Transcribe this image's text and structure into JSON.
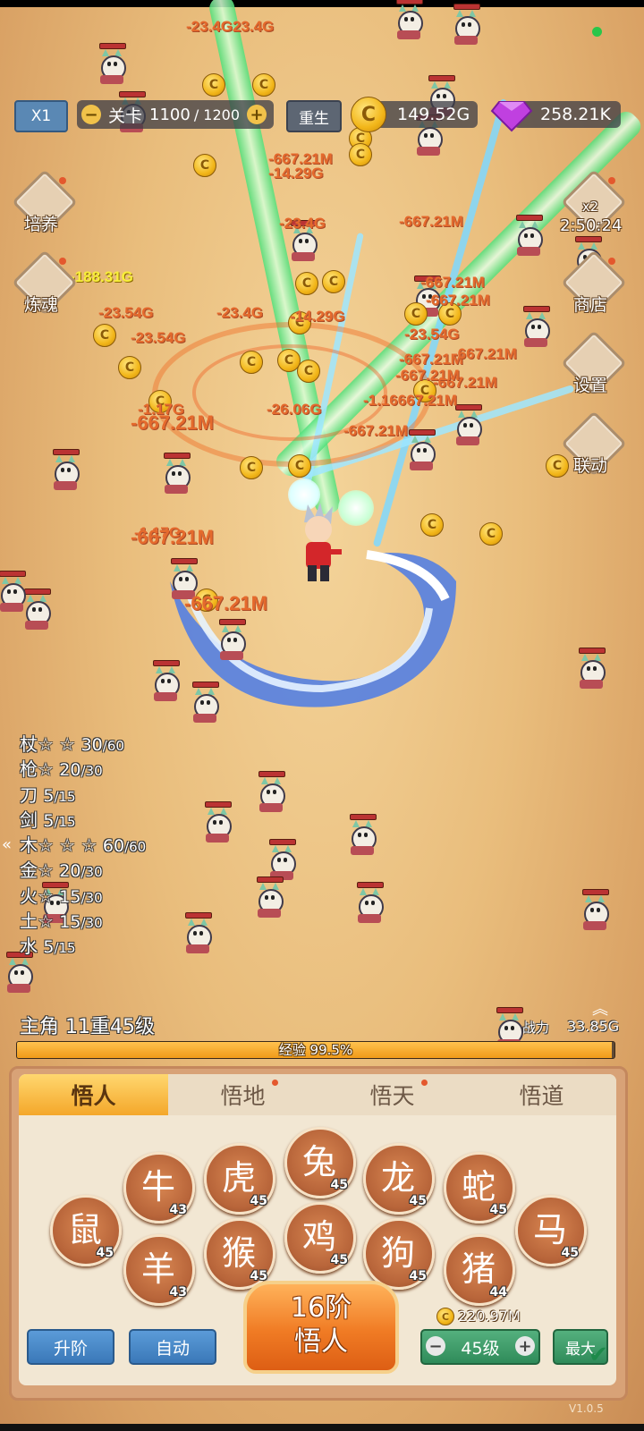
{
  "hud": {
    "speed_label": "X1",
    "level_label": "关卡",
    "level_current": "1100",
    "level_max": "/ 1200",
    "rebirth_label": "重生",
    "gold": "149.52G",
    "gems": "258.21K"
  },
  "side_left": [
    {
      "label": "培养"
    },
    {
      "label": "炼魂"
    }
  ],
  "side_right": [
    {
      "label": "x2",
      "timer": "2:50:24"
    },
    {
      "label": "商店"
    },
    {
      "label": "设置"
    },
    {
      "label": "联动"
    }
  ],
  "damage_texts": [
    "-23.4G23.4G",
    "-667.21M",
    "-14.29G",
    "-23.4G",
    "-667.21M",
    "-188.31G",
    "-23.54G",
    "-23.54G",
    "-23.4G",
    "-667.21M",
    "-14.29G",
    "-23.54G",
    "-667.21M",
    "-667.21M",
    "-667.21M",
    "-667.21M",
    "-1.17G",
    "-26.06G",
    "-1.16667.21M",
    "-667.21M",
    "-667.21M",
    "-1.17G",
    "-667.21M",
    "-667.21M",
    "-667.21M"
  ],
  "weapons": [
    {
      "name": "杖",
      "stars": "☆ ☆",
      "level": "30",
      "max": "/60"
    },
    {
      "name": "枪",
      "stars": "☆",
      "level": "20",
      "max": "/30"
    },
    {
      "name": "刀",
      "stars": "",
      "level": "5",
      "max": "/15"
    },
    {
      "name": "剑",
      "stars": "",
      "level": "5",
      "max": "/15"
    },
    {
      "name": "木",
      "stars": "☆ ☆ ☆",
      "level": "60",
      "max": "/60"
    },
    {
      "name": "金",
      "stars": "☆",
      "level": "20",
      "max": "/30"
    },
    {
      "name": "火",
      "stars": "☆",
      "level": "15",
      "max": "/30"
    },
    {
      "name": "土",
      "stars": "☆",
      "level": "15",
      "max": "/30"
    },
    {
      "name": "水",
      "stars": "",
      "level": "5",
      "max": "/15"
    }
  ],
  "hero": {
    "label": "主角",
    "rank": "11重45级",
    "power_label": "战力",
    "power": "33.85G",
    "exp_label": "经验 99.5%",
    "exp_fraction": 0.995
  },
  "panel": {
    "tabs": [
      "悟人",
      "悟地",
      "悟天",
      "悟道"
    ],
    "zodiac": [
      {
        "icon": "rat-icon",
        "glyph": "鼠",
        "level": "45"
      },
      {
        "icon": "ox-icon",
        "glyph": "牛",
        "level": "43"
      },
      {
        "icon": "tiger-icon",
        "glyph": "虎",
        "level": "45"
      },
      {
        "icon": "rabbit-icon",
        "glyph": "兔",
        "level": "45"
      },
      {
        "icon": "dragon-icon",
        "glyph": "龙",
        "level": "45"
      },
      {
        "icon": "snake-icon",
        "glyph": "蛇",
        "level": "45"
      },
      {
        "icon": "horse-icon",
        "glyph": "马",
        "level": "45"
      },
      {
        "icon": "goat-icon",
        "glyph": "羊",
        "level": "43"
      },
      {
        "icon": "monkey-icon",
        "glyph": "猴",
        "level": "45"
      },
      {
        "icon": "rooster-icon",
        "glyph": "鸡",
        "level": "45"
      },
      {
        "icon": "dog-icon",
        "glyph": "狗",
        "level": "45"
      },
      {
        "icon": "pig-icon",
        "glyph": "猪",
        "level": "44"
      }
    ],
    "upgrade_label": "升阶",
    "auto_label": "自动",
    "big_button_line1": "16阶",
    "big_button_line2": "悟人",
    "cost": "220.97M",
    "level_select": "45级",
    "max_label": "最大",
    "version": "V1.0.5"
  }
}
